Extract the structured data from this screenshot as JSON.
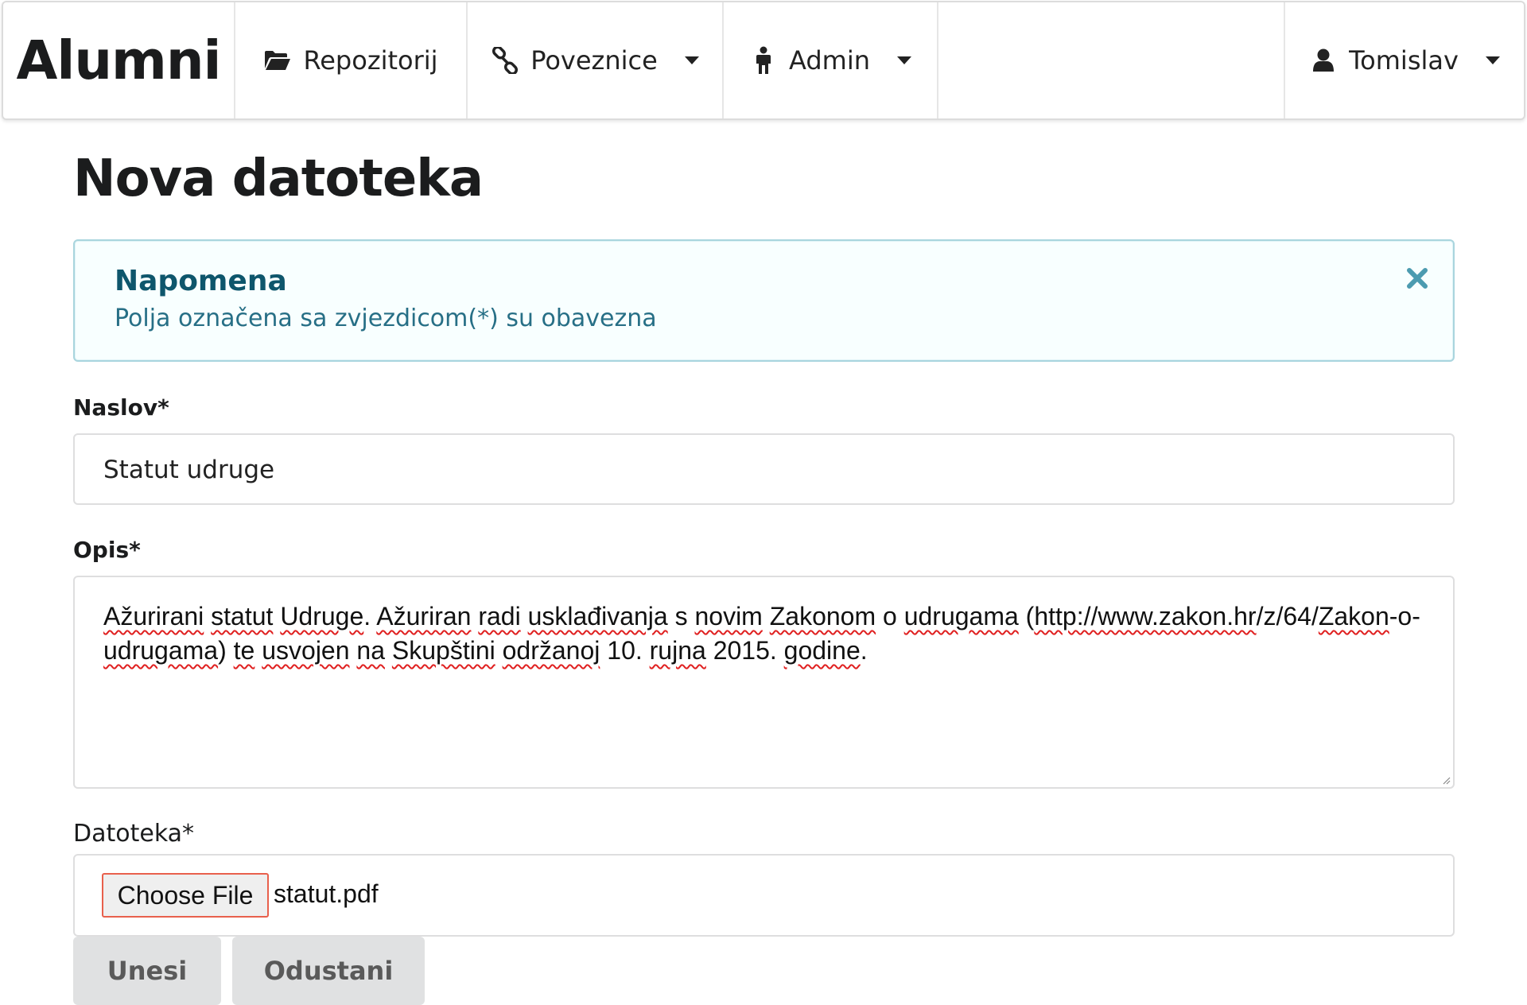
{
  "navbar": {
    "brand": "Alumni",
    "items": [
      {
        "label": "Repozitorij",
        "icon": "folder-open-icon",
        "has_dropdown": false
      },
      {
        "label": "Poveznice",
        "icon": "link-icon",
        "has_dropdown": true
      },
      {
        "label": "Admin",
        "icon": "person-icon",
        "has_dropdown": true
      }
    ],
    "user": {
      "label": "Tomislav",
      "icon": "user-icon",
      "has_dropdown": true
    }
  },
  "page": {
    "title": "Nova datoteka"
  },
  "notice": {
    "header": "Napomena",
    "text": "Polja označena sa zvjezdicom(*) su obavezna",
    "close_icon": "close-icon"
  },
  "form": {
    "title_label": "Naslov*",
    "title_value": "Statut udruge",
    "description_label": "Opis*",
    "description_words": [
      {
        "t": "Ažurirani",
        "err": true
      },
      {
        "t": " ",
        "err": false
      },
      {
        "t": "statut",
        "err": true
      },
      {
        "t": " ",
        "err": false
      },
      {
        "t": "Udruge",
        "err": true
      },
      {
        "t": ". ",
        "err": false
      },
      {
        "t": "Ažuriran",
        "err": true
      },
      {
        "t": " ",
        "err": false
      },
      {
        "t": "radi",
        "err": true
      },
      {
        "t": " ",
        "err": false
      },
      {
        "t": "usklađivanja",
        "err": true
      },
      {
        "t": " s ",
        "err": false
      },
      {
        "t": "novim",
        "err": true
      },
      {
        "t": " ",
        "err": false
      },
      {
        "t": "Zakonom",
        "err": true
      },
      {
        "t": " o ",
        "err": false
      },
      {
        "t": "udrugama",
        "err": true
      },
      {
        "t": " (",
        "err": false
      },
      {
        "t": "http://www.zakon.hr",
        "err": true
      },
      {
        "t": "/z/64/",
        "err": false
      },
      {
        "t": "Zakon",
        "err": true
      },
      {
        "t": "-o-",
        "err": false
      },
      {
        "t": "udrugama",
        "err": true
      },
      {
        "t": ") ",
        "err": false
      },
      {
        "t": "te",
        "err": true
      },
      {
        "t": " ",
        "err": false
      },
      {
        "t": "usvojen",
        "err": true
      },
      {
        "t": " ",
        "err": false
      },
      {
        "t": "na",
        "err": true
      },
      {
        "t": " ",
        "err": false
      },
      {
        "t": "Skupštini",
        "err": true
      },
      {
        "t": " ",
        "err": false
      },
      {
        "t": "održanoj",
        "err": true
      },
      {
        "t": " 10. ",
        "err": false
      },
      {
        "t": "rujna",
        "err": true
      },
      {
        "t": " 2015. ",
        "err": false
      },
      {
        "t": "godine",
        "err": true
      },
      {
        "t": ".",
        "err": false
      }
    ],
    "file_label": "Datoteka*",
    "file_button": "Choose File",
    "file_name": "statut.pdf",
    "submit_label": "Unesi",
    "cancel_label": "Odustani"
  },
  "colors": {
    "notice_border": "#a9d5de",
    "notice_header": "#0e566c",
    "notice_text": "#276f86",
    "notice_close": "#4c9bb0",
    "button_bg": "#e0e1e2",
    "file_button_border": "#e8604c"
  }
}
